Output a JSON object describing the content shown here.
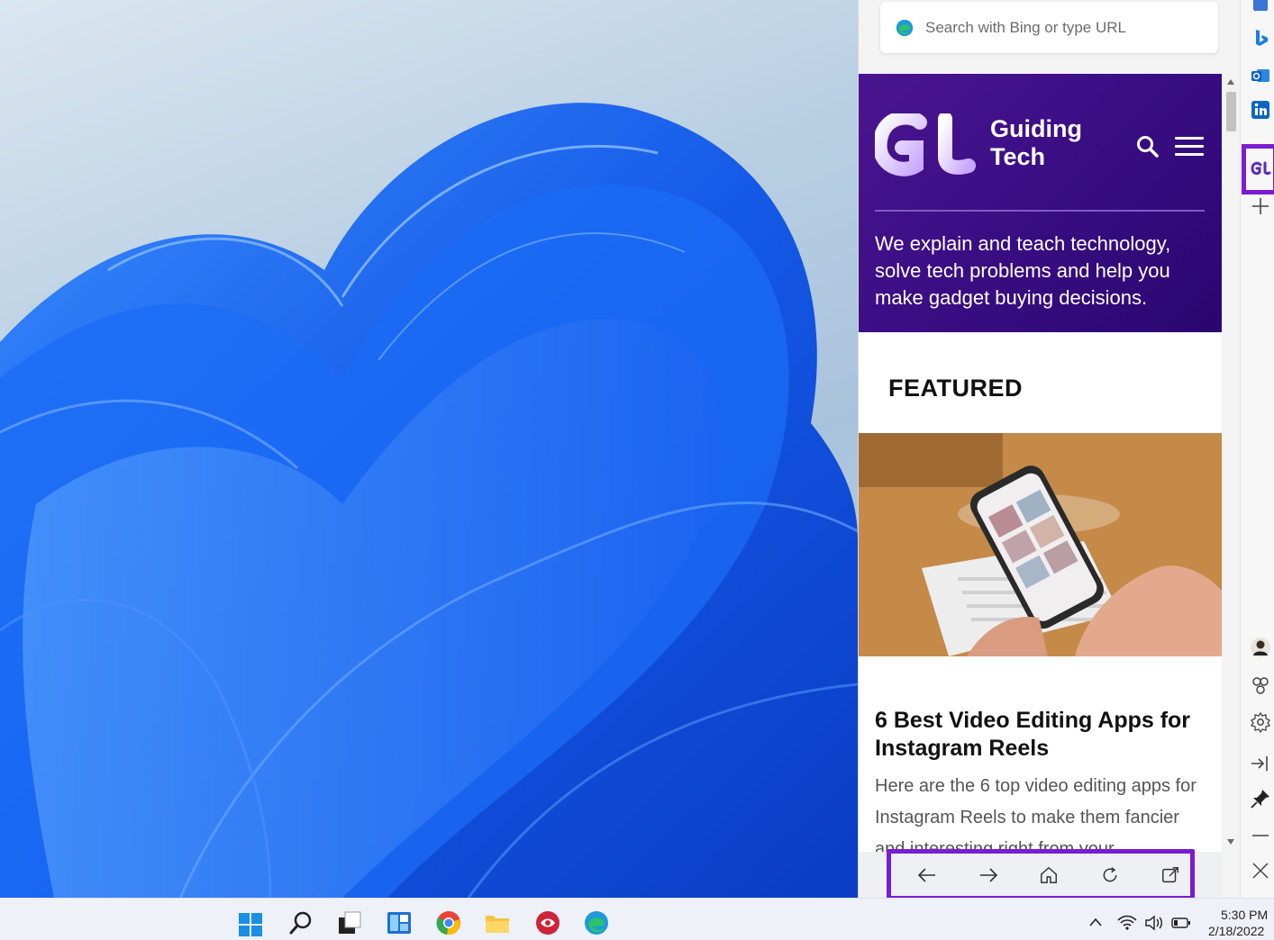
{
  "sidebar": {
    "search_placeholder": "Search with Bing or type URL",
    "site": {
      "brand_line1": "Guiding",
      "brand_line2": "Tech",
      "tagline": "We explain and teach technology, solve tech problems and help you make gadget buying decisions.",
      "section_label": "FEATURED",
      "article_title": "6 Best Video Editing Apps for Instagram Reels",
      "article_desc": "Here are the 6 top video editing apps for Instagram Reels to make them fancier and interesting right from your"
    },
    "nav_buttons": [
      "back-icon",
      "forward-icon",
      "home-icon",
      "refresh-icon",
      "open-in-new-icon"
    ]
  },
  "edge_strip": {
    "top_icons": [
      "office-icon",
      "bing-icon",
      "outlook-icon",
      "linkedin-icon",
      "guiding-tech-icon",
      "add-icon"
    ],
    "bottom_icons": [
      "avatar",
      "trophy-icon",
      "settings-icon",
      "collapse-icon",
      "pin-icon",
      "minimize-icon",
      "close-icon"
    ]
  },
  "taskbar": {
    "apps": [
      "start-icon",
      "search-icon",
      "task-view-icon",
      "widgets-icon",
      "chrome-icon",
      "file-explorer-icon",
      "app-icon",
      "edge-icon"
    ],
    "time": "5:30 PM",
    "date": "2/18/2022"
  },
  "colors": {
    "highlight": "#7a1dd1",
    "brand_purple": "#3d0f86",
    "wallpaper_blue": "#1a5ee8"
  }
}
